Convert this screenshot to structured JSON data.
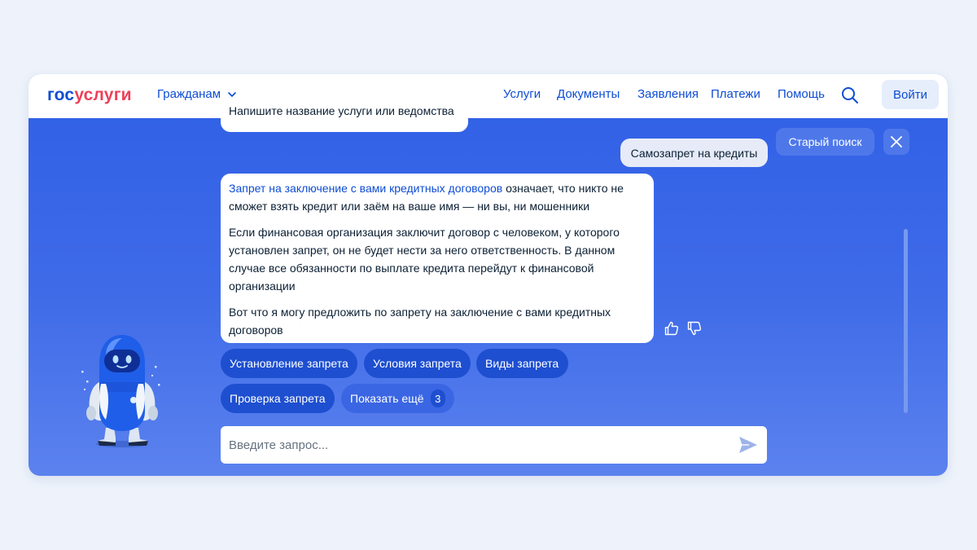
{
  "header": {
    "logo_part1": "гос",
    "logo_part2": "услуги",
    "audience_label": "Гражданам",
    "nav": [
      "Услуги",
      "Документы",
      "Заявления",
      "Платежи",
      "Помощь"
    ],
    "login_label": "Войти"
  },
  "chat": {
    "prev_bot_message": "Напишите название услуги или ведомства",
    "user_message": "Самозапрет на кредиты",
    "old_search_label": "Старый поиск",
    "bot_message": {
      "link_text": "Запрет на заключение с вами кредитных договоров",
      "para1_rest": " означает, что никто не сможет взять кредит или заём на ваше имя — ни вы, ни мошенники",
      "para2": "Если финансовая организация заключит договор с человеком, у которого установлен запрет, он не будет нести за него ответственность. В данном случае все обязанности по выплате кредита перейдут к финансовой организации",
      "para3": "Вот что я могу предложить по запрету на заключение с вами кредитных договоров"
    },
    "suggestions": [
      "Установление запрета",
      "Условия запрета",
      "Виды запрета",
      "Проверка запрета"
    ],
    "show_more_label": "Показать ещё",
    "show_more_count": "3",
    "input_placeholder": "Введите запрос...",
    "input_value": ""
  },
  "icons": {
    "search": "search-icon",
    "chevron": "chevron-down-icon",
    "close": "close-icon",
    "like": "thumbs-up-icon",
    "dislike": "thumbs-down-icon",
    "send": "send-icon",
    "mascot": "robot-mascot"
  },
  "colors": {
    "brand_blue": "#0d4cd3",
    "brand_red": "#ee3f58",
    "chat_bg": "#3f6be8",
    "chip_bg": "#1e4fd0"
  }
}
